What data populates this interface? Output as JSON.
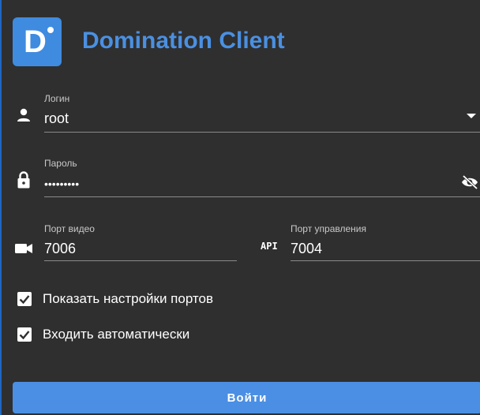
{
  "app": {
    "title": "Domination Client",
    "logo_letter": "D"
  },
  "form": {
    "login": {
      "label": "Логин",
      "value": "root",
      "icon": "person-icon",
      "trailing_icon": "dropdown-arrow-icon"
    },
    "password": {
      "label": "Пароль",
      "value": "•••••••••",
      "icon": "lock-icon",
      "trailing_icon": "eye-off-icon"
    },
    "video_port": {
      "label": "Порт видео",
      "value": "7006",
      "icon": "videocam-icon"
    },
    "control_port": {
      "label": "Порт управления",
      "value": "7004",
      "icon_text": "API"
    },
    "show_ports": {
      "label": "Показать настройки портов",
      "checked": true
    },
    "auto_login": {
      "label": "Входить автоматически",
      "checked": true
    },
    "submit_label": "Войти"
  },
  "colors": {
    "background": "#2f2f2f",
    "accent": "#4a8fe3",
    "title": "#4a90e2"
  }
}
